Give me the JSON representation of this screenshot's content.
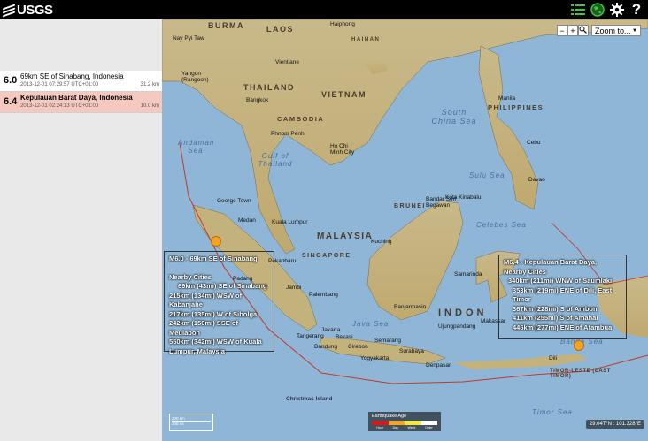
{
  "header": {
    "logo_text": "USGS",
    "icons": [
      "list-icon",
      "globe-icon",
      "gear-icon",
      "help-icon"
    ],
    "help_label": "?"
  },
  "earthquakes": [
    {
      "mag": "6.0",
      "place": "69km SE of Sinabang, Indonesia",
      "time": "2013-12-01 07:29:57 UTC+01:00",
      "depth": "31.2 km",
      "color": "#ffffff"
    },
    {
      "mag": "6.4",
      "place": "Kepulauan Barat Daya, Indonesia",
      "time": "2013-12-01 02:24:13 UTC+01:00",
      "depth": "10.0 km",
      "color": "#f6c9c0"
    }
  ],
  "map_controls": {
    "zoom_out": "−",
    "zoom_in": "+",
    "zoom_to": "Zoom to..."
  },
  "labels": {
    "countries": [
      "BURMA",
      "LAOS",
      "THAILAND",
      "VIETNAM",
      "CAMBODIA",
      "MALAYSIA",
      "PHILIPPINES",
      "BRUNEI",
      "SINGAPORE",
      "INDON",
      "TIMOR-LESTE (EAST TIMOR)",
      "HAINAN"
    ],
    "seas": [
      "South China Sea",
      "Gulf of Thailand",
      "Andaman Sea",
      "Sulu Sea",
      "Celebes Sea",
      "Java Sea",
      "Timor Sea",
      "Banda Sea"
    ],
    "cities": [
      "Haiphong",
      "Nay Pyi Taw",
      "Vientiane",
      "Yangon (Rangoon)",
      "Bangkok",
      "Phnom Penh",
      "Ho Chi Minh City",
      "Manila",
      "Cebu",
      "Davao",
      "George Town",
      "Medan",
      "Kuala Lumpur",
      "Kuching",
      "Bandar Seri Begawan",
      "Samarinda",
      "Banjarmasin",
      "Palembang",
      "Jakarta",
      "Tangerang",
      "Bekasi",
      "Bandung",
      "Cirebon",
      "Semarang",
      "Surabaya",
      "Yogyakarta",
      "Denpasar",
      "Ujungpandang",
      "Padang",
      "Pekanbaru",
      "Jambi",
      "Makassar",
      "Kota Kinabalu",
      "Dili",
      "Christmas Island"
    ]
  },
  "popups": [
    {
      "title": "M6.0 - 69km SE of Sinabang",
      "subtitle": "Nearby Cities",
      "lines": [
        "69km (43mi) SE of Sinabang",
        "215km (134mi) WSW of Kabanjahe",
        "217km (135mi) W of Sibolga",
        "242km (150mi) SSE of Meulaboh",
        "550km (342mi) WSW of Kuala",
        "Lumpur, Malaysia"
      ]
    },
    {
      "title": "M6.4 - Kepulauan Barat Daya,",
      "subtitle": "Nearby Cities",
      "lines": [
        "340km (211mi) WNW of Saumlaki",
        "353km (219mi) ENE of Dili, East Timor",
        "367km (228mi) S of Ambon",
        "411km (255mi) S of Amahai",
        "446km (277mi) ENE of Atambua"
      ]
    }
  ],
  "legend": {
    "title": "Earthquake Age",
    "captions": [
      "Hour",
      "Day",
      "Week",
      "Older"
    ],
    "colors": [
      "#d7191c",
      "#f5a623",
      "#f5e53b",
      "#ffffff"
    ]
  },
  "scale": {
    "top": "200 km",
    "bottom": "200 mi"
  },
  "coords": "29.047°N : 101.328°E"
}
